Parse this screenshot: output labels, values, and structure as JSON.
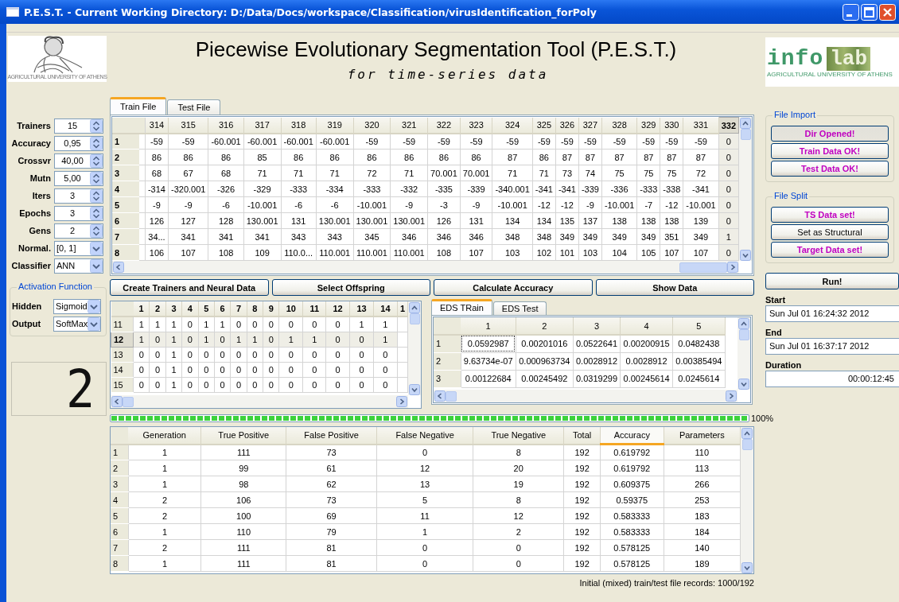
{
  "window": {
    "title": "P.E.S.T. - Current Working Directory: D:/Data/Docs/workspace/Classification/virusIdentification_forPoly"
  },
  "header": {
    "title": "Piecewise Evolutionary Segmentation Tool (P.E.S.T.)",
    "subtitle": "for time-series data",
    "left_logo": {
      "caption": "AGRICULTURAL UNIVERSITY OF ATHENS"
    },
    "right_logo": {
      "word": "info",
      "badge": "lab",
      "caption": "AGRICULTURAL UNIVERSITY OF ATHENS"
    }
  },
  "parameters": [
    {
      "label": "Trainers",
      "kind": "spin",
      "value": "15"
    },
    {
      "label": "Accuracy",
      "kind": "spin",
      "value": "0,95"
    },
    {
      "label": "Crossvr",
      "kind": "spin",
      "value": "40,00"
    },
    {
      "label": "Mutn",
      "kind": "spin",
      "value": "5,00"
    },
    {
      "label": "Iters",
      "kind": "spin",
      "value": "3"
    },
    {
      "label": "Epochs",
      "kind": "spin",
      "value": "3"
    },
    {
      "label": "Gens",
      "kind": "spin",
      "value": "2"
    },
    {
      "label": "Normal.",
      "kind": "combo",
      "value": "[0, 1]"
    },
    {
      "label": "Classifier",
      "kind": "combo",
      "value": "ANN"
    }
  ],
  "activation": {
    "title": "Activation Function",
    "fields": [
      {
        "label": "Hidden",
        "value": "Sigmoid"
      },
      {
        "label": "Output",
        "value": "SoftMax"
      }
    ]
  },
  "display": {
    "digit": "2"
  },
  "file_tabs": [
    {
      "label": "Train File",
      "selected": true
    },
    {
      "label": "Test File",
      "selected": false
    }
  ],
  "data_table": {
    "columns": [
      {
        "label": "314",
        "selected": false
      },
      {
        "label": "315",
        "selected": false
      },
      {
        "label": "316",
        "selected": false
      },
      {
        "label": "317",
        "selected": false
      },
      {
        "label": "318",
        "selected": false
      },
      {
        "label": "319",
        "selected": false
      },
      {
        "label": "320",
        "selected": false
      },
      {
        "label": "321",
        "selected": false
      },
      {
        "label": "322",
        "selected": false
      },
      {
        "label": "323",
        "selected": false
      },
      {
        "label": "324",
        "selected": false
      },
      {
        "label": "325",
        "selected": false
      },
      {
        "label": "326",
        "selected": false
      },
      {
        "label": "327",
        "selected": false
      },
      {
        "label": "328",
        "selected": false
      },
      {
        "label": "329",
        "selected": false
      },
      {
        "label": "330",
        "selected": false
      },
      {
        "label": "331",
        "selected": false
      },
      {
        "label": "332",
        "selected": true
      }
    ],
    "rows": [
      {
        "header": "1",
        "cells": [
          "-59",
          "-59",
          "-60.001",
          "-60.001",
          "-60.001",
          "-60.001",
          "-59",
          "-59",
          "-59",
          "-59",
          "-59",
          "-59",
          "-59",
          "-59",
          "-59",
          "-59",
          "-59",
          "-59",
          "0"
        ]
      },
      {
        "header": "2",
        "cells": [
          "86",
          "86",
          "86",
          "85",
          "86",
          "86",
          "86",
          "86",
          "86",
          "86",
          "87",
          "86",
          "87",
          "87",
          "87",
          "87",
          "87",
          "87",
          "0"
        ]
      },
      {
        "header": "3",
        "cells": [
          "68",
          "67",
          "68",
          "71",
          "71",
          "71",
          "72",
          "71",
          "70.001",
          "70.001",
          "71",
          "71",
          "73",
          "74",
          "75",
          "75",
          "75",
          "72",
          "0"
        ]
      },
      {
        "header": "4",
        "cells": [
          "-314",
          "-320.001",
          "-326",
          "-329",
          "-333",
          "-334",
          "-333",
          "-332",
          "-335",
          "-339",
          "-340.001",
          "-341",
          "-341",
          "-339",
          "-336",
          "-333",
          "-338",
          "-341",
          "0"
        ]
      },
      {
        "header": "5",
        "cells": [
          "-9",
          "-9",
          "-6",
          "-10.001",
          "-6",
          "-6",
          "-10.001",
          "-9",
          "-3",
          "-9",
          "-10.001",
          "-12",
          "-12",
          "-9",
          "-10.001",
          "-7",
          "-12",
          "-10.001",
          "0"
        ]
      },
      {
        "header": "6",
        "cells": [
          "126",
          "127",
          "128",
          "130.001",
          "131",
          "130.001",
          "130.001",
          "130.001",
          "126",
          "131",
          "134",
          "134",
          "135",
          "137",
          "138",
          "138",
          "138",
          "139",
          "0"
        ]
      },
      {
        "header": "7",
        "cells": [
          "34...",
          "341",
          "341",
          "341",
          "343",
          "343",
          "345",
          "346",
          "346",
          "346",
          "348",
          "348",
          "349",
          "349",
          "349",
          "349",
          "351",
          "349",
          "1"
        ]
      },
      {
        "header": "8",
        "cells": [
          "106",
          "107",
          "108",
          "109",
          "110.0...",
          "110.001",
          "110.001",
          "110.001",
          "108",
          "107",
          "103",
          "102",
          "101",
          "103",
          "104",
          "105",
          "107",
          "107",
          "0"
        ]
      }
    ]
  },
  "actions": [
    "Create Trainers and Neural Data",
    "Select Offspring",
    "Calculate Accuracy",
    "Show Data"
  ],
  "binary_table": {
    "columns": [
      "1",
      "2",
      "3",
      "4",
      "5",
      "6",
      "7",
      "8",
      "9",
      "10",
      "11",
      "12",
      "13",
      "14",
      "1"
    ],
    "rows": [
      {
        "header": "11",
        "selected": false,
        "cells": [
          "1",
          "1",
          "1",
          "0",
          "1",
          "1",
          "0",
          "0",
          "0",
          "0",
          "0",
          "0",
          "1",
          "1"
        ]
      },
      {
        "header": "12",
        "selected": true,
        "cells": [
          "1",
          "0",
          "1",
          "0",
          "1",
          "0",
          "1",
          "1",
          "0",
          "1",
          "1",
          "0",
          "0",
          "1"
        ]
      },
      {
        "header": "13",
        "selected": false,
        "cells": [
          "0",
          "0",
          "1",
          "0",
          "0",
          "0",
          "0",
          "0",
          "0",
          "0",
          "0",
          "0",
          "0",
          "0"
        ]
      },
      {
        "header": "14",
        "selected": false,
        "cells": [
          "0",
          "0",
          "1",
          "0",
          "0",
          "0",
          "0",
          "0",
          "0",
          "0",
          "0",
          "0",
          "0",
          "0"
        ]
      },
      {
        "header": "15",
        "selected": false,
        "cells": [
          "0",
          "0",
          "1",
          "0",
          "0",
          "0",
          "0",
          "0",
          "0",
          "0",
          "0",
          "0",
          "0",
          "0"
        ]
      }
    ]
  },
  "eds_tabs": [
    {
      "label": "EDS TRain",
      "selected": true
    },
    {
      "label": "EDS Test",
      "selected": false
    }
  ],
  "eds_table": {
    "columns": [
      "1",
      "2",
      "3",
      "4",
      "5"
    ],
    "rows": [
      {
        "header": "1",
        "cells": [
          "0.0592987",
          "0.00201016",
          "0.0522641",
          "0.00200915",
          "0.0482438"
        ]
      },
      {
        "header": "2",
        "cells": [
          "9.63734e-07",
          "0.000963734",
          "0.0028912",
          "0.0028912",
          "0.00385494"
        ]
      },
      {
        "header": "3",
        "cells": [
          "0.00122684",
          "0.00245492",
          "0.0319299",
          "0.00245614",
          "0.0245614"
        ]
      }
    ]
  },
  "progress": {
    "level": 1,
    "reading": "100%"
  },
  "results_table": {
    "columns": [
      {
        "label": "Generation",
        "sorted": false
      },
      {
        "label": "True Positive",
        "sorted": false
      },
      {
        "label": "False Positive",
        "sorted": false
      },
      {
        "label": "False Negative",
        "sorted": false
      },
      {
        "label": "True Negative",
        "sorted": false
      },
      {
        "label": "Total",
        "sorted": false
      },
      {
        "label": "Accuracy",
        "sorted": true
      },
      {
        "label": "Parameters",
        "sorted": false
      }
    ],
    "rows": [
      {
        "header": "1",
        "cells": [
          "1",
          "111",
          "73",
          "0",
          "8",
          "192",
          "0.619792",
          "110"
        ]
      },
      {
        "header": "2",
        "cells": [
          "1",
          "99",
          "61",
          "12",
          "20",
          "192",
          "0.619792",
          "113"
        ]
      },
      {
        "header": "3",
        "cells": [
          "1",
          "98",
          "62",
          "13",
          "19",
          "192",
          "0.609375",
          "266"
        ]
      },
      {
        "header": "4",
        "cells": [
          "2",
          "106",
          "73",
          "5",
          "8",
          "192",
          "0.59375",
          "253"
        ]
      },
      {
        "header": "5",
        "cells": [
          "2",
          "100",
          "69",
          "11",
          "12",
          "192",
          "0.583333",
          "183"
        ]
      },
      {
        "header": "6",
        "cells": [
          "1",
          "110",
          "79",
          "1",
          "2",
          "192",
          "0.583333",
          "184"
        ]
      },
      {
        "header": "7",
        "cells": [
          "2",
          "111",
          "81",
          "0",
          "0",
          "192",
          "0.578125",
          "140"
        ]
      },
      {
        "header": "8",
        "cells": [
          "1",
          "111",
          "81",
          "0",
          "0",
          "192",
          "0.578125",
          "189"
        ]
      }
    ]
  },
  "status": "Initial (mixed) train/test file records: 1000/192",
  "file_import": {
    "title": "File Import",
    "buttons": [
      {
        "label": "Dir Opened!",
        "done": true,
        "pressed": true
      },
      {
        "label": "Train Data OK!",
        "done": true,
        "pressed": false
      },
      {
        "label": "Test Data OK!",
        "done": true,
        "pressed": false
      }
    ]
  },
  "file_split": {
    "title": "File Split",
    "buttons": [
      {
        "label": "TS Data set!",
        "done": true,
        "pressed": false
      },
      {
        "label": "Set as Structural",
        "done": false,
        "pressed": false
      },
      {
        "label": "Target Data set!",
        "done": true,
        "pressed": false
      }
    ]
  },
  "run_button": "Run!",
  "times": [
    {
      "label": "Start",
      "kind": "timestamp",
      "value": "Sun Jul 01 16:24:32 2012"
    },
    {
      "label": "End",
      "kind": "timestamp",
      "value": "Sun Jul 01 16:37:17 2012"
    },
    {
      "label": "Duration",
      "kind": "elapsed",
      "value": "00:00:12:45"
    }
  ]
}
